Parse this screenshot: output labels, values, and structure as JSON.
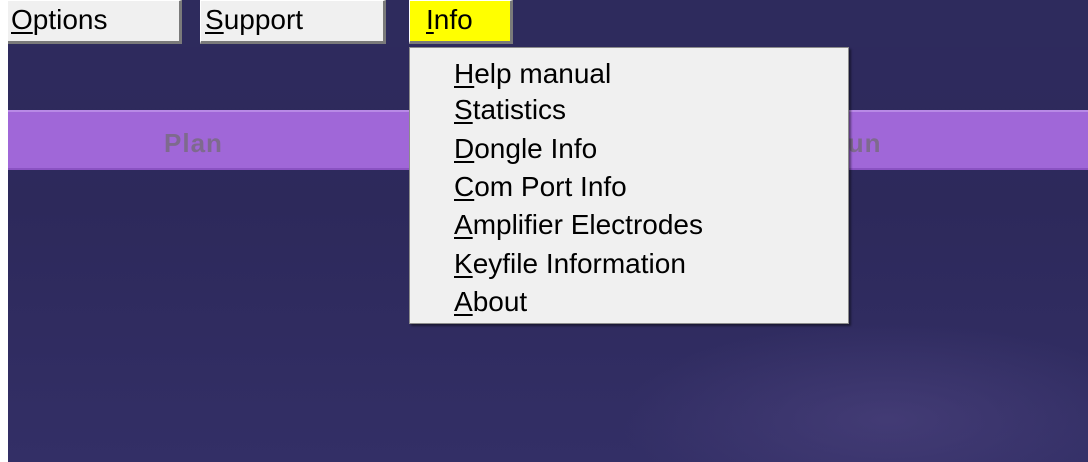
{
  "menubar": {
    "items": [
      {
        "accel": "O",
        "rest": "ptions",
        "label": "Options"
      },
      {
        "accel": "S",
        "rest": "upport",
        "label": "Support"
      },
      {
        "accel": "I",
        "rest": "nfo",
        "label": "Info",
        "active": true
      }
    ]
  },
  "strip": {
    "left_label": "Plan",
    "right_label": "Run"
  },
  "info_menu": {
    "items": [
      {
        "accel": "H",
        "rest": "elp manual",
        "label": "Help manual"
      },
      {
        "accel": "S",
        "rest": "tatistics",
        "label": "Statistics"
      },
      {
        "accel": "D",
        "rest": "ongle Info",
        "label": "Dongle Info"
      },
      {
        "accel": "C",
        "rest": "om Port Info",
        "label": "Com Port Info"
      },
      {
        "accel": "A",
        "rest": "mplifier Electrodes",
        "label": "Amplifier Electrodes"
      },
      {
        "accel": "K",
        "rest": "eyfile Information",
        "label": "Keyfile Information"
      },
      {
        "accel": "A",
        "rest": "bout",
        "label": "About"
      }
    ]
  },
  "colors": {
    "background": "#2e2a5e",
    "strip": "#a067d8",
    "strip_text": "#7e6a8e",
    "active_menu": "#ffff00",
    "menu_face": "#f0f0f0"
  }
}
